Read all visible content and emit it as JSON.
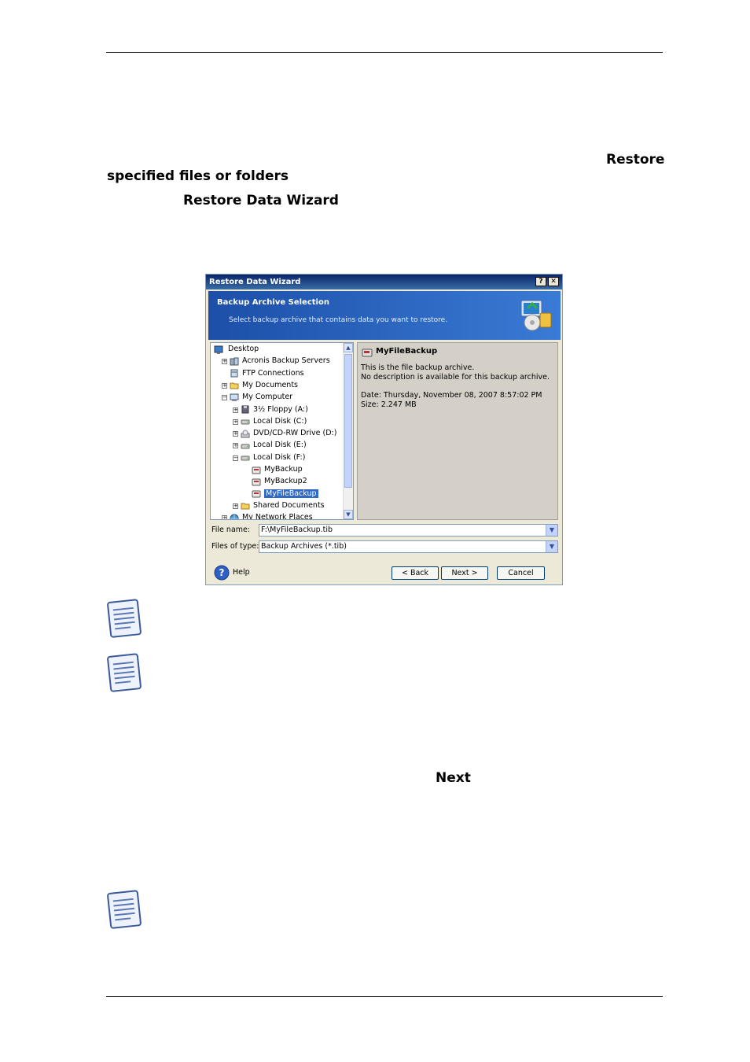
{
  "doc": {
    "bold_restore": "Restore",
    "bold_specified": "specified files or folders",
    "bold_wizard": "Restore Data Wizard",
    "bold_next": "Next"
  },
  "dialog": {
    "title": "Restore Data Wizard",
    "help_btn": "?",
    "close_btn": "✕",
    "header_title": "Backup Archive Selection",
    "header_subtitle": "Select backup archive that contains data you want to restore.",
    "tree": [
      {
        "label": "Desktop",
        "icon": "desktop-icon",
        "level": 0,
        "expander": ""
      },
      {
        "label": "Acronis Backup Servers",
        "icon": "servers-icon",
        "level": 1,
        "expander": "+"
      },
      {
        "label": "FTP Connections",
        "icon": "ftp-icon",
        "level": 1,
        "expander": ""
      },
      {
        "label": "My Documents",
        "icon": "folder-icon",
        "level": 1,
        "expander": "+"
      },
      {
        "label": "My Computer",
        "icon": "computer-icon",
        "level": 1,
        "expander": "-"
      },
      {
        "label": "3½ Floppy (A:)",
        "icon": "floppy-icon",
        "level": 2,
        "expander": "+"
      },
      {
        "label": "Local Disk (C:)",
        "icon": "disk-icon",
        "level": 2,
        "expander": "+"
      },
      {
        "label": "DVD/CD-RW Drive (D:)",
        "icon": "cdrom-icon",
        "level": 2,
        "expander": "+"
      },
      {
        "label": "Local Disk (E:)",
        "icon": "disk-icon",
        "level": 2,
        "expander": "+"
      },
      {
        "label": "Local Disk (F:)",
        "icon": "disk-icon",
        "level": 2,
        "expander": "-"
      },
      {
        "label": "MyBackup",
        "icon": "archive-icon",
        "level": 3,
        "expander": ""
      },
      {
        "label": "MyBackup2",
        "icon": "archive-icon",
        "level": 3,
        "expander": ""
      },
      {
        "label": "MyFileBackup",
        "icon": "archive-icon",
        "level": 3,
        "expander": "",
        "selected": true
      },
      {
        "label": "Shared Documents",
        "icon": "folder-icon",
        "level": 2,
        "expander": "+"
      },
      {
        "label": "My Network Places",
        "icon": "network-icon",
        "level": 1,
        "expander": "+"
      }
    ],
    "info": {
      "name": "MyFileBackup",
      "line1": "This is the file backup archive.",
      "line2": "No description is available for this backup archive.",
      "date": "Date: Thursday, November 08, 2007 8:57:02 PM",
      "size": "Size: 2.247 MB"
    },
    "file_name_label": "File name:",
    "file_name_value": "F:\\MyFileBackup.tib",
    "file_type_label": "Files of type:",
    "file_type_value": "Backup Archives (*.tib)",
    "help_label": "Help",
    "back_label": "< Back",
    "next_label": "Next >",
    "cancel_label": "Cancel"
  }
}
